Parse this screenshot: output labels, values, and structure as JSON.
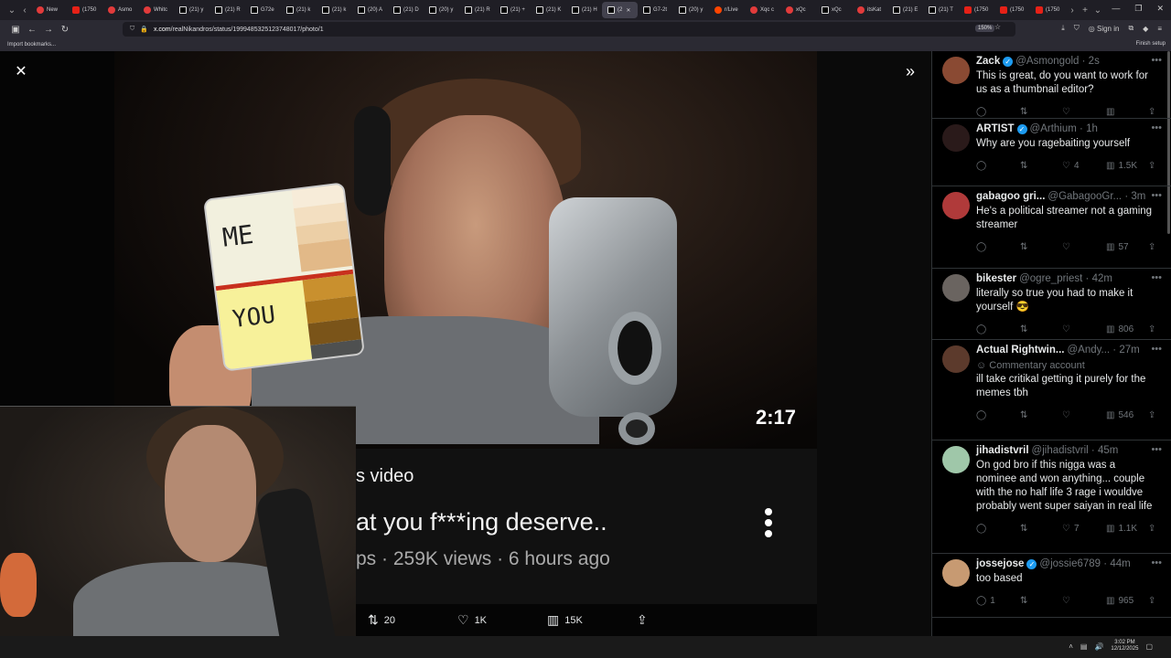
{
  "browser": {
    "tabs": [
      {
        "label": "New",
        "icon": "red"
      },
      {
        "label": "(1750",
        "icon": "yt"
      },
      {
        "label": "Asmo",
        "icon": "red"
      },
      {
        "label": "Whitc",
        "icon": "red"
      },
      {
        "label": "(21) y",
        "icon": "x"
      },
      {
        "label": "(21) R",
        "icon": "x"
      },
      {
        "label": "G72e",
        "icon": "x"
      },
      {
        "label": "(21) k",
        "icon": "x"
      },
      {
        "label": "(21) k",
        "icon": "x"
      },
      {
        "label": "(20) A",
        "icon": "x"
      },
      {
        "label": "(21) D",
        "icon": "x"
      },
      {
        "label": "(20) y",
        "icon": "x"
      },
      {
        "label": "(21) R",
        "icon": "x"
      },
      {
        "label": "(21) +",
        "icon": "x"
      },
      {
        "label": "(21) K",
        "icon": "x"
      },
      {
        "label": "(21) H",
        "icon": "x"
      },
      {
        "label": "(2",
        "icon": "x",
        "active": true
      },
      {
        "label": "G7-2t",
        "icon": "x"
      },
      {
        "label": "(20) y",
        "icon": "x"
      },
      {
        "label": "r/Live",
        "icon": "reddit"
      },
      {
        "label": "Xqc c",
        "icon": "red"
      },
      {
        "label": "xQc",
        "icon": "red"
      },
      {
        "label": "xQc",
        "icon": "x"
      },
      {
        "label": "itsKat",
        "icon": "red"
      },
      {
        "label": "(21) E",
        "icon": "x"
      },
      {
        "label": "(21) T",
        "icon": "x"
      },
      {
        "label": "(1750",
        "icon": "yt"
      },
      {
        "label": "(1750",
        "icon": "yt"
      },
      {
        "label": "(1750",
        "icon": "yt"
      }
    ],
    "url_host": "x.com",
    "url_path": "/realNikandros/status/1999485325123748017/photo/1",
    "zoom": "150%",
    "sign_in": "Sign in",
    "bookmarks_label": "Import bookmarks...",
    "finish_setup": "Finish setup"
  },
  "media": {
    "card_top": "ME",
    "card_bottom": "YOU",
    "duration": "2:17",
    "overlay_line1": "s video",
    "overlay_line2": "at you f***ing deserve..",
    "overlay_line3": "ps · 259K views · 6 hours ago",
    "retweets": "20",
    "likes": "1K",
    "views": "15K"
  },
  "replies": [
    {
      "name": "Zack",
      "verified": true,
      "handle": "@Asmongold",
      "time": "2s",
      "text": "This is great, do you want to work for us as a thumbnail editor?",
      "reply": "",
      "retweet": "",
      "like": "",
      "views": "",
      "avatar": "#8a4a33"
    },
    {
      "name": "ARTIST",
      "verified": true,
      "handle": "@Arthium",
      "time": "1h",
      "text": "Why are you ragebaiting yourself",
      "reply": "",
      "retweet": "",
      "like": "4",
      "views": "1.5K",
      "avatar": "#2a1a1a"
    },
    {
      "name": "gabagoo gri...",
      "verified": false,
      "handle": "@GabagooGr...",
      "time": "3m",
      "text": "He's a political streamer not a gaming streamer",
      "reply": "",
      "retweet": "",
      "like": "",
      "views": "57",
      "avatar": "#b03a3a"
    },
    {
      "name": "bikester",
      "verified": false,
      "handle": "@ogre_priest",
      "time": "42m",
      "text": "literally so true you had to make it yourself 😎",
      "reply": "",
      "retweet": "",
      "like": "",
      "views": "806",
      "avatar": "#6a6460"
    },
    {
      "name": "Actual Rightwin...",
      "verified": false,
      "handle": "@Andy...",
      "time": "27m",
      "commentary": "Commentary account",
      "text": "ill take critikal getting it purely for the memes tbh",
      "reply": "",
      "retweet": "",
      "like": "",
      "views": "546",
      "avatar": "#5c3a2c"
    },
    {
      "name": "jihadistvril",
      "verified": false,
      "handle": "@jihadistvril",
      "time": "45m",
      "text": "On god bro if this nigga was a nominee and won anything... couple with the no half life 3 rage i wouldve probably went super saiyan in real life",
      "reply": "",
      "retweet": "",
      "like": "7",
      "views": "1.1K",
      "avatar": "#9fc7a9"
    },
    {
      "name": "jossejose",
      "verified": true,
      "handle": "@jossie6789",
      "time": "44m",
      "text": "too based",
      "reply": "1",
      "retweet": "",
      "like": "",
      "views": "965",
      "avatar": "#c79a72"
    }
  ],
  "taskbar": {
    "time": "3:02 PM",
    "date": "12/12/2025"
  },
  "colors": {
    "accent": "#1d9bf0",
    "background": "#000000",
    "muted": "#71767b"
  }
}
